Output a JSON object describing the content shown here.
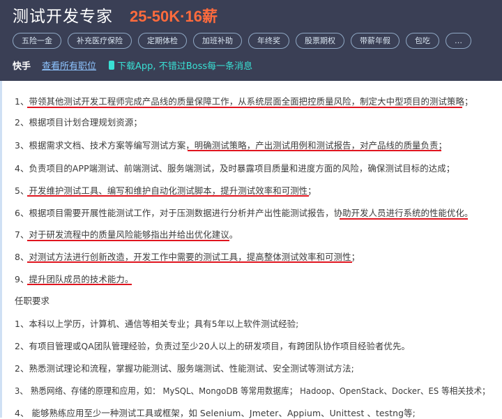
{
  "header": {
    "job_title": "测试开发专家",
    "salary": "25-50K·16薪",
    "tags": [
      "五险一金",
      "补充医疗保险",
      "定期体检",
      "加班补助",
      "年终奖",
      "股票期权",
      "带薪年假",
      "包吃",
      "…"
    ],
    "company": "快手",
    "view_all_link": "查看所有职位",
    "download_text": "下载App, 不错过Boss每一条消息"
  },
  "duties": [
    "1、带领其他测试开发工程师完成产品线的质量保障工作，从系统层面全面把控质量风险，制定大中型项目的测试策略；",
    "2、根据项目计划合理规划资源；",
    "3、根据需求文档、技术方案等编写测试方案，明确测试策略，产出测试用例和测试报告，对产品线的质量负责；",
    "4、负责项目的APP端测试、前端测试、服务端测试，及时暴露项目质量和进度方面的风险，确保测试目标的达成；",
    "5、开发维护测试工具、编写和维护自动化测试脚本，提升测试效率和可测性；",
    "6、根据项目需要开展性能测试工作，对于压测数据进行分析并产出性能测试报告，协助开发人员进行系统的性能优化。",
    "7、对于研发流程中的质量风险能够指出并给出优化建议。",
    "8、对测试方法进行创新改造，开发工作中需要的测试工具，提高整体测试效率和可测性；",
    "9、提升团队成员的技术能力。"
  ],
  "requirements_title": "任职要求",
  "requirements": [
    "1、本科以上学历，计算机、通信等相关专业；具有5年以上软件测试经验;",
    "2、有项目管理或QA团队管理经验，负责过至少20人以上的研发项目，有跨团队协作项目经验者优先。",
    "2、熟悉测试理论和流程，掌握功能测试、服务端测试、性能测试、安全测试等测试方法;",
    "3、 熟悉网络、存储的原理和应用，如： MySQL、MongoDB 等常用数据库； Hadoop、OpenStack、Docker、ES 等相关技术；",
    "4、 能够熟练应用至少一种测试工具或框架，如 Selenium、Jmeter、Appium、Unittest 、testng等;"
  ],
  "colors": {
    "header_bg": "#3a3f55",
    "salary": "#ff6b3d",
    "link": "#8ec4ff",
    "download": "#39e0d4",
    "underline": "#e0151f"
  }
}
